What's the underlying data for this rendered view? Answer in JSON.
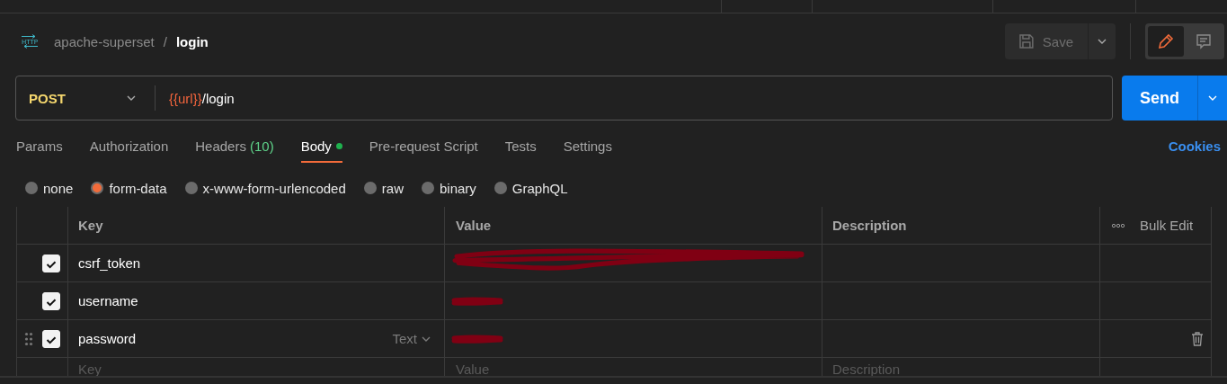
{
  "breadcrumb": {
    "icon_label": "HTTP",
    "collection": "apache-superset",
    "separator": "/",
    "request": "login"
  },
  "toolbar": {
    "save": "Save",
    "modes": [
      {
        "kind": "edit",
        "selected": true
      },
      {
        "kind": "comment",
        "selected": false
      }
    ]
  },
  "request": {
    "method": "POST",
    "url_variable": "{{url}}",
    "url_path": "/login",
    "send": "Send"
  },
  "tabs": [
    {
      "label": "Params",
      "selected": false
    },
    {
      "label": "Authorization",
      "selected": false
    },
    {
      "label": "Headers",
      "count": "(10)",
      "selected": false
    },
    {
      "label": "Body",
      "selected": true,
      "has_content": true
    },
    {
      "label": "Pre-request Script",
      "selected": false
    },
    {
      "label": "Tests",
      "selected": false
    },
    {
      "label": "Settings",
      "selected": false
    }
  ],
  "cookies_link": "Cookies",
  "body_types": [
    {
      "label": "none",
      "selected": false
    },
    {
      "label": "form-data",
      "selected": true
    },
    {
      "label": "x-www-form-urlencoded",
      "selected": false
    },
    {
      "label": "raw",
      "selected": false
    },
    {
      "label": "binary",
      "selected": false
    },
    {
      "label": "GraphQL",
      "selected": false
    }
  ],
  "table": {
    "columns": [
      "Key",
      "Value",
      "Description"
    ],
    "bulk_edit": "Bulk Edit",
    "rows": [
      {
        "key": "csrf_token",
        "checked": true,
        "value_redaction": {
          "kind": "long"
        },
        "hovered": false
      },
      {
        "key": "username",
        "checked": true,
        "value_redaction": {
          "kind": "short"
        },
        "hovered": false
      },
      {
        "key": "password",
        "checked": true,
        "value_redaction": {
          "kind": "short"
        },
        "hovered": true,
        "type": "Text"
      }
    ],
    "new_row": {
      "key_placeholder": "Key",
      "value_placeholder": "Value",
      "description_placeholder": "Description"
    }
  }
}
